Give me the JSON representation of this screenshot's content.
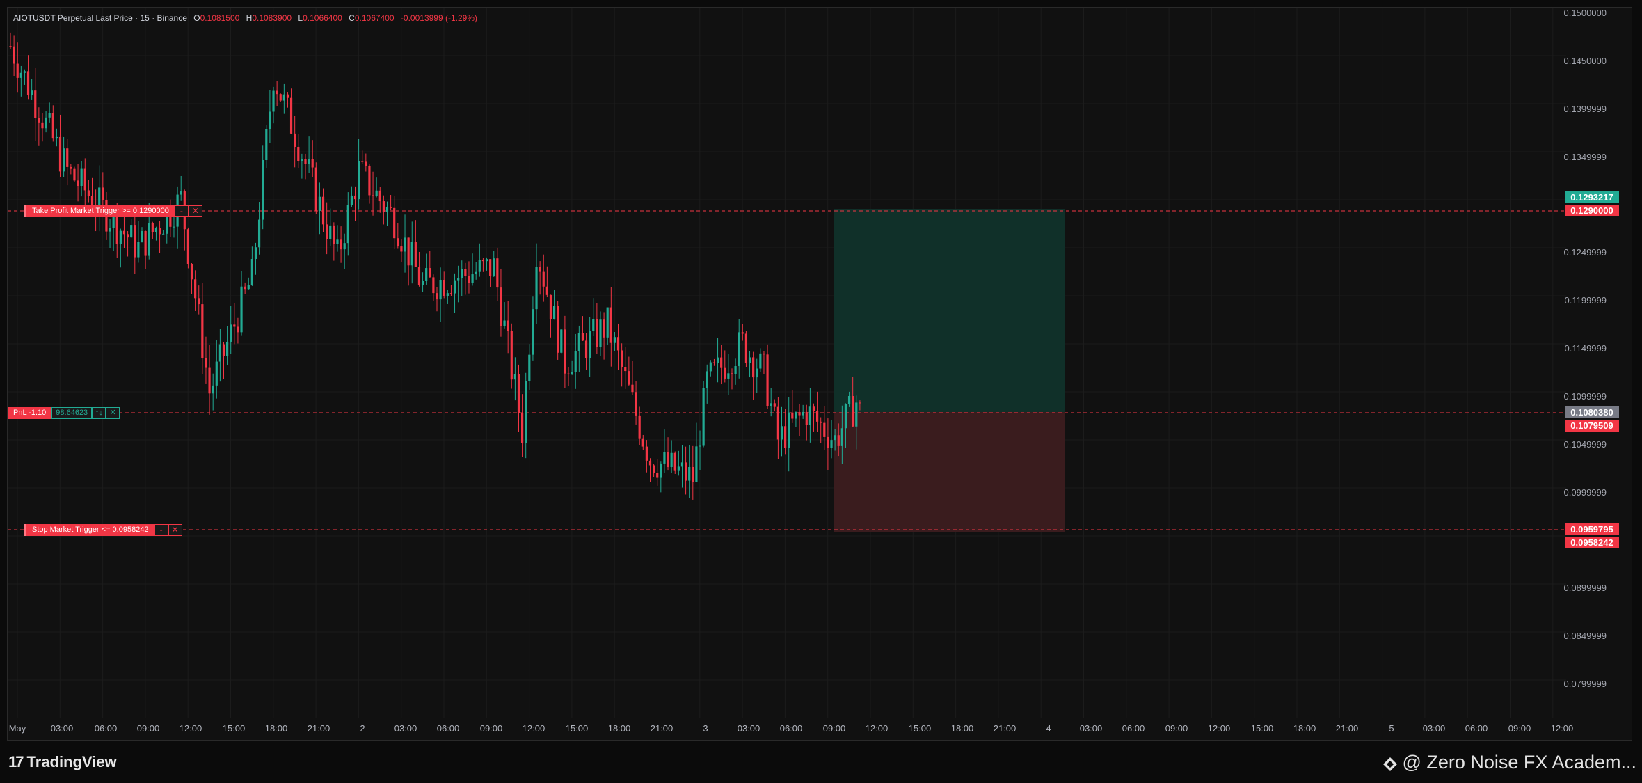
{
  "header": {
    "symbol": "AIOTUSDT Perpetual Last Price · 15 · Binance",
    "open_label": "O",
    "open": "0.1081500",
    "high_label": "H",
    "high": "0.1083900",
    "low_label": "L",
    "low": "0.1066400",
    "close_label": "C",
    "close": "0.1067400",
    "change": "-0.0013999 (-1.29%)"
  },
  "price_axis": {
    "labels": [
      "0.1500000",
      "0.1450000",
      "0.1399999",
      "0.1349999",
      "0.1249999",
      "0.1199999",
      "0.1149999",
      "0.1099999",
      "0.1049999",
      "0.0999999",
      "0.0899999",
      "0.0849999",
      "0.0799999"
    ],
    "tags": {
      "tp_target": "0.1293217",
      "tp_order": "0.1290000",
      "current_gray": "0.1080380",
      "current_red": "0.1079509",
      "sl_target": "0.0959795",
      "sl_order": "0.0958242"
    }
  },
  "time_axis": {
    "labels": [
      "May",
      "03:00",
      "06:00",
      "09:00",
      "12:00",
      "15:00",
      "18:00",
      "21:00",
      "2",
      "03:00",
      "06:00",
      "09:00",
      "12:00",
      "15:00",
      "18:00",
      "21:00",
      "3",
      "03:00",
      "06:00",
      "09:00",
      "12:00",
      "15:00",
      "18:00",
      "21:00",
      "4",
      "03:00",
      "06:00",
      "09:00",
      "12:00",
      "15:00",
      "18:00",
      "21:00",
      "5",
      "03:00",
      "06:00",
      "09:00",
      "12:00"
    ]
  },
  "orders": {
    "take_profit": {
      "label": "Take Profit Market Trigger >= 0.1290000",
      "minus": "-",
      "close": "✕"
    },
    "stop_loss": {
      "label": "Stop Market Trigger <= 0.0958242",
      "minus": "-",
      "close": "✕"
    },
    "position": {
      "pnl": "PnL -1.10",
      "qty": "98.64623",
      "reverse": "↑↓",
      "close": "✕"
    }
  },
  "footer": {
    "brand_logo": "17",
    "brand_name": "TradingView",
    "watermark": "@ Zero Noise FX Academ..."
  },
  "colors": {
    "bull": "#22ab94",
    "bear": "#f23645",
    "background": "#111111",
    "profit_zone": "#103029",
    "loss_zone": "#3a1c1e"
  },
  "chart_data": {
    "type": "candlestick",
    "interval": "15",
    "x_range": [
      "May 1 00:00",
      "May 5 12:00"
    ],
    "ylim": [
      0.075,
      0.15
    ],
    "grid": true,
    "key_points": [
      {
        "x": "May 1 00:00",
        "y": 0.146
      },
      {
        "x": "May 1 04:00",
        "y": 0.133
      },
      {
        "x": "May 1 09:00",
        "y": 0.125
      },
      {
        "x": "May 1 12:00",
        "y": 0.13
      },
      {
        "x": "May 1 14:00",
        "y": 0.11
      },
      {
        "x": "May 1 17:00",
        "y": 0.122
      },
      {
        "x": "May 1 18:30",
        "y": 0.143
      },
      {
        "x": "May 1 20:00",
        "y": 0.137
      },
      {
        "x": "May 1 23:00",
        "y": 0.124
      },
      {
        "x": "May 2 00:30",
        "y": 0.133
      },
      {
        "x": "May 2 03:00",
        "y": 0.128
      },
      {
        "x": "May 2 05:00",
        "y": 0.121
      },
      {
        "x": "May 2 10:00",
        "y": 0.123
      },
      {
        "x": "May 2 12:00",
        "y": 0.106
      },
      {
        "x": "May 2 13:00",
        "y": 0.125
      },
      {
        "x": "May 2 15:00",
        "y": 0.113
      },
      {
        "x": "May 2 18:00",
        "y": 0.117
      },
      {
        "x": "May 2 21:00",
        "y": 0.103
      },
      {
        "x": "May 3 00:00",
        "y": 0.101
      },
      {
        "x": "May 3 01:00",
        "y": 0.111
      },
      {
        "x": "May 3 03:30",
        "y": 0.115
      },
      {
        "x": "May 3 05:00",
        "y": 0.112
      },
      {
        "x": "May 3 06:00",
        "y": 0.105
      },
      {
        "x": "May 3 08:00",
        "y": 0.108
      },
      {
        "x": "May 3 10:00",
        "y": 0.105
      },
      {
        "x": "May 3 11:30",
        "y": 0.109
      },
      {
        "x": "May 3 12:00",
        "y": 0.1067
      }
    ],
    "position_box": {
      "entry": 0.108038,
      "take_profit": 0.1293217,
      "stop_loss": 0.0959795,
      "x_start": "May 3 12:00",
      "x_end": "May 4 06:00"
    }
  }
}
